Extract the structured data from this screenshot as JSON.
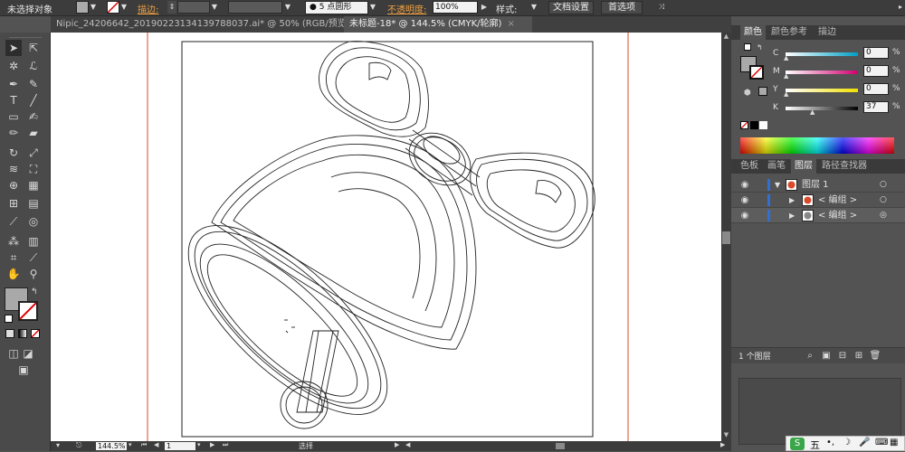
{
  "control_bar": {
    "selection_status": "未选择对象",
    "stroke_label": "描边:",
    "brush_label": "5 点圆形",
    "opacity_label": "不透明度:",
    "opacity_value": "100%",
    "style_label": "样式:",
    "doc_setup_button": "文档设置",
    "preferences_button": "首选项"
  },
  "tabs": [
    {
      "label": "Nipic_24206642_20190223134139788037.ai* @ 50% (RGB/预览)",
      "close": "×"
    },
    {
      "label": "未标题-18* @ 144.5% (CMYK/轮廓)",
      "close": "×"
    }
  ],
  "color_panel": {
    "tabs": [
      "颜色",
      "颜色参考",
      "描边"
    ],
    "channels": [
      {
        "label": "C",
        "value": "0",
        "pct": "%"
      },
      {
        "label": "M",
        "value": "0",
        "pct": "%"
      },
      {
        "label": "Y",
        "value": "0",
        "pct": "%"
      },
      {
        "label": "K",
        "value": "37",
        "pct": "%"
      }
    ]
  },
  "layers_panel": {
    "tabs": [
      "色板",
      "画笔",
      "图层",
      "路径查找器"
    ],
    "rows": [
      {
        "name": "图层 1"
      },
      {
        "name": "< 编组 >"
      },
      {
        "name": "< 编组 >"
      }
    ],
    "count_label": "1 个图层"
  },
  "status_bar": {
    "zoom": "144.5%",
    "artboard": "1",
    "tool_label": "选择"
  },
  "ime": {
    "mode": "五"
  },
  "colors": {
    "accent_orange": "#f0a040",
    "panel_bg": "#535353",
    "layer_blue": "#2f6fd6"
  }
}
